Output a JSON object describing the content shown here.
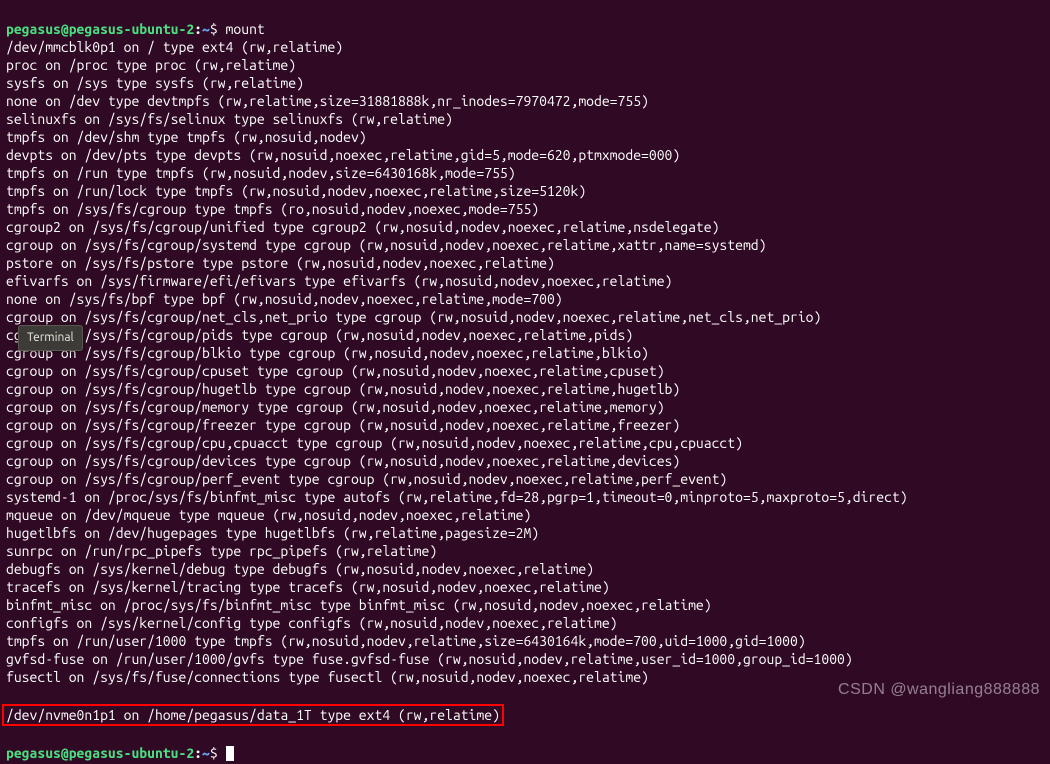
{
  "prompt": {
    "user_host": "pegasus@pegasus-ubuntu-2",
    "separator": ":",
    "path": "~",
    "symbol": "$"
  },
  "command": "mount",
  "tooltip": "Terminal",
  "watermark": "CSDN @wangliang888888",
  "output_lines": [
    "/dev/mmcblk0p1 on / type ext4 (rw,relatime)",
    "proc on /proc type proc (rw,relatime)",
    "sysfs on /sys type sysfs (rw,relatime)",
    "none on /dev type devtmpfs (rw,relatime,size=31881888k,nr_inodes=7970472,mode=755)",
    "selinuxfs on /sys/fs/selinux type selinuxfs (rw,relatime)",
    "tmpfs on /dev/shm type tmpfs (rw,nosuid,nodev)",
    "devpts on /dev/pts type devpts (rw,nosuid,noexec,relatime,gid=5,mode=620,ptmxmode=000)",
    "tmpfs on /run type tmpfs (rw,nosuid,nodev,size=6430168k,mode=755)",
    "tmpfs on /run/lock type tmpfs (rw,nosuid,nodev,noexec,relatime,size=5120k)",
    "tmpfs on /sys/fs/cgroup type tmpfs (ro,nosuid,nodev,noexec,mode=755)",
    "cgroup2 on /sys/fs/cgroup/unified type cgroup2 (rw,nosuid,nodev,noexec,relatime,nsdelegate)",
    "cgroup on /sys/fs/cgroup/systemd type cgroup (rw,nosuid,nodev,noexec,relatime,xattr,name=systemd)",
    "pstore on /sys/fs/pstore type pstore (rw,nosuid,nodev,noexec,relatime)",
    "efivarfs on /sys/firmware/efi/efivars type efivarfs (rw,nosuid,nodev,noexec,relatime)",
    "none on /sys/fs/bpf type bpf (rw,nosuid,nodev,noexec,relatime,mode=700)",
    "cgroup on /sys/fs/cgroup/net_cls,net_prio type cgroup (rw,nosuid,nodev,noexec,relatime,net_cls,net_prio)",
    "cgroup on /sys/fs/cgroup/pids type cgroup (rw,nosuid,nodev,noexec,relatime,pids)",
    "cgroup on /sys/fs/cgroup/blkio type cgroup (rw,nosuid,nodev,noexec,relatime,blkio)",
    "cgroup on /sys/fs/cgroup/cpuset type cgroup (rw,nosuid,nodev,noexec,relatime,cpuset)",
    "cgroup on /sys/fs/cgroup/hugetlb type cgroup (rw,nosuid,nodev,noexec,relatime,hugetlb)",
    "cgroup on /sys/fs/cgroup/memory type cgroup (rw,nosuid,nodev,noexec,relatime,memory)",
    "cgroup on /sys/fs/cgroup/freezer type cgroup (rw,nosuid,nodev,noexec,relatime,freezer)",
    "cgroup on /sys/fs/cgroup/cpu,cpuacct type cgroup (rw,nosuid,nodev,noexec,relatime,cpu,cpuacct)",
    "cgroup on /sys/fs/cgroup/devices type cgroup (rw,nosuid,nodev,noexec,relatime,devices)",
    "cgroup on /sys/fs/cgroup/perf_event type cgroup (rw,nosuid,nodev,noexec,relatime,perf_event)",
    "systemd-1 on /proc/sys/fs/binfmt_misc type autofs (rw,relatime,fd=28,pgrp=1,timeout=0,minproto=5,maxproto=5,direct)",
    "mqueue on /dev/mqueue type mqueue (rw,nosuid,nodev,noexec,relatime)",
    "hugetlbfs on /dev/hugepages type hugetlbfs (rw,relatime,pagesize=2M)",
    "sunrpc on /run/rpc_pipefs type rpc_pipefs (rw,relatime)",
    "debugfs on /sys/kernel/debug type debugfs (rw,nosuid,nodev,noexec,relatime)",
    "tracefs on /sys/kernel/tracing type tracefs (rw,nosuid,nodev,noexec,relatime)",
    "binfmt_misc on /proc/sys/fs/binfmt_misc type binfmt_misc (rw,nosuid,nodev,noexec,relatime)",
    "configfs on /sys/kernel/config type configfs (rw,nosuid,nodev,noexec,relatime)",
    "tmpfs on /run/user/1000 type tmpfs (rw,nosuid,nodev,relatime,size=6430164k,mode=700,uid=1000,gid=1000)",
    "gvfsd-fuse on /run/user/1000/gvfs type fuse.gvfsd-fuse (rw,nosuid,nodev,relatime,user_id=1000,group_id=1000)",
    "fusectl on /sys/fs/fuse/connections type fusectl (rw,nosuid,nodev,noexec,relatime)"
  ],
  "highlighted_line": "/dev/nvme0n1p1 on /home/pegasus/data_1T type ext4 (rw,relatime)"
}
